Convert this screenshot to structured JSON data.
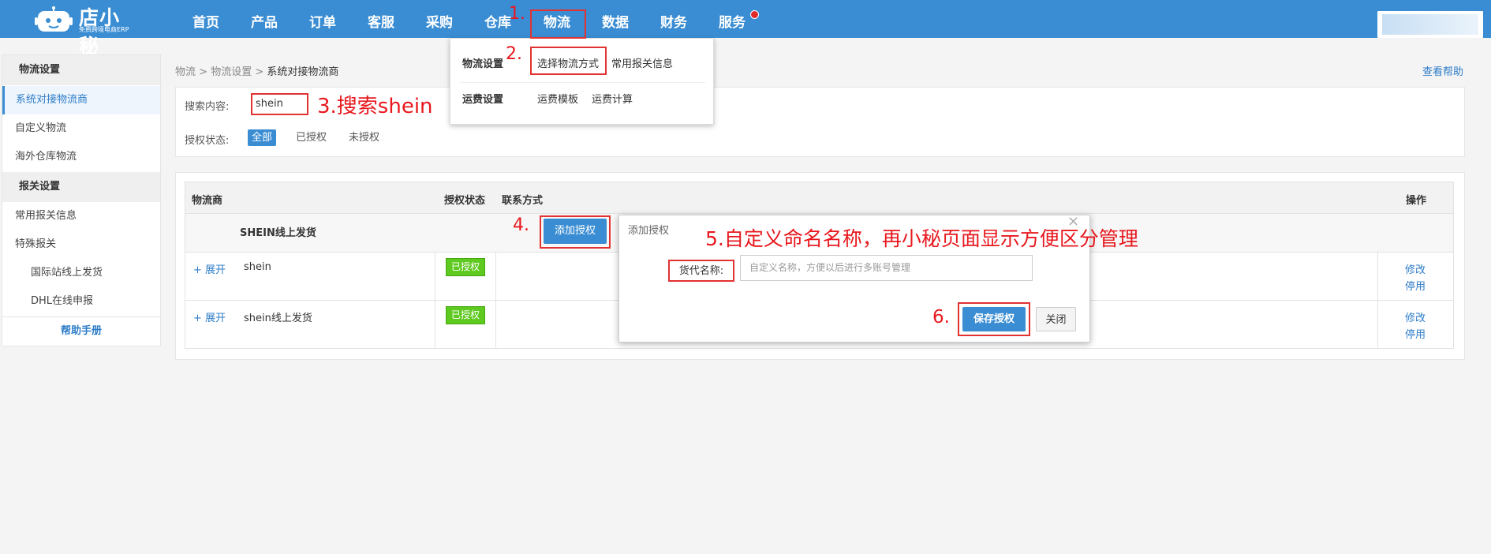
{
  "logo": {
    "title": "店小秘",
    "subtitle": "免费跨境电商ERP"
  },
  "nav": {
    "items": [
      "首页",
      "产品",
      "订单",
      "客服",
      "采购",
      "仓库",
      "物流",
      "数据",
      "财务",
      "服务"
    ]
  },
  "sidebar": {
    "section1": "物流设置",
    "items1": [
      "系统对接物流商",
      "自定义物流",
      "海外仓库物流"
    ],
    "section2": "报关设置",
    "items2": [
      "常用报关信息",
      "特殊报关"
    ],
    "subitems": [
      "国际站线上发货",
      "DHL在线申报"
    ],
    "help": "帮助手册"
  },
  "breadcrumb": {
    "l1": "物流",
    "sep": ">",
    "l2": "物流设置",
    "cur": "系统对接物流商"
  },
  "help_link": "查看帮助",
  "search": {
    "label": "搜索内容:",
    "value": "shein"
  },
  "filter": {
    "label": "授权状态:",
    "all": "全部",
    "authorized": "已授权",
    "unauthorized": "未授权"
  },
  "table": {
    "headers": {
      "carrier": "物流商",
      "status": "授权状态",
      "contact": "联系方式",
      "ops": "操作"
    },
    "group_name": "SHEIN线上发货",
    "add_auth": "添加授权",
    "rows": [
      {
        "expand": "+ 展开",
        "name": "shein",
        "status": "已授权",
        "edit": "修改",
        "disable": "停用"
      },
      {
        "expand": "+ 展开",
        "name": "shein线上发货",
        "status": "已授权",
        "edit": "修改",
        "disable": "停用"
      }
    ]
  },
  "mega_menu": {
    "logistics_settings": "物流设置",
    "choose_method": "选择物流方式",
    "customs_info": "常用报关信息",
    "freight_settings": "运费设置",
    "freight_template": "运费模板",
    "freight_calc": "运费计算"
  },
  "dialog": {
    "title": "添加授权",
    "close": "×",
    "label": "货代名称:",
    "placeholder": "自定义名称，方便以后进行多账号管理",
    "save": "保存授权",
    "cancel": "关闭"
  },
  "annotations": {
    "a1": "1.",
    "a2": "2.",
    "a3": "3.搜索shein",
    "a4": "4.",
    "a5": "5.自定义命名名称，再小秘页面显示方便区分管理",
    "a6": "6."
  },
  "colors": {
    "primary": "#3a8dd3",
    "annotation_red": "#e23232",
    "badge_green": "#5ec91f"
  }
}
